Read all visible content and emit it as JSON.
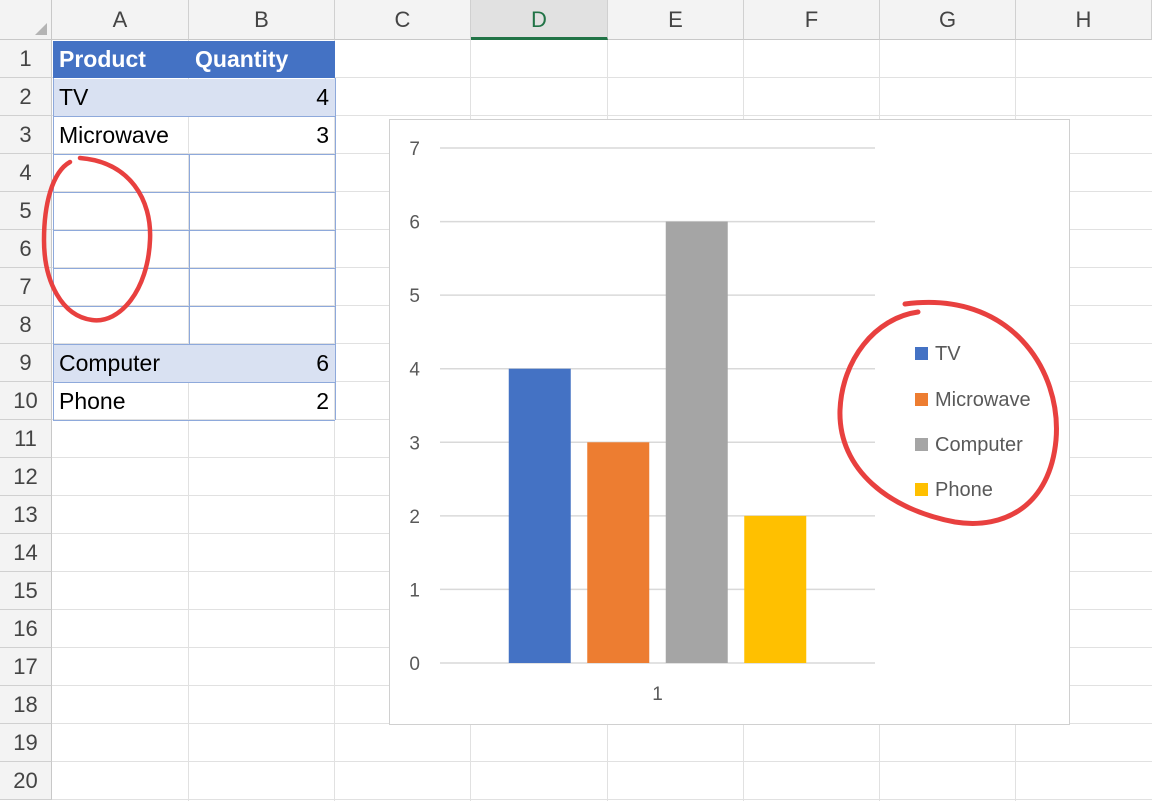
{
  "columns": [
    "A",
    "B",
    "C",
    "D",
    "E",
    "F",
    "G",
    "H"
  ],
  "selected_column": "D",
  "rows": [
    "1",
    "2",
    "3",
    "4",
    "5",
    "6",
    "7",
    "8",
    "9",
    "10",
    "11",
    "12",
    "13",
    "14",
    "15",
    "16",
    "17",
    "18",
    "19",
    "20"
  ],
  "table": {
    "headers": {
      "product": "Product",
      "quantity": "Quantity"
    },
    "data": [
      {
        "product": "TV",
        "quantity": "4"
      },
      {
        "product": "Microwave",
        "quantity": "3"
      },
      {
        "product": "",
        "quantity": ""
      },
      {
        "product": "",
        "quantity": ""
      },
      {
        "product": "",
        "quantity": ""
      },
      {
        "product": "",
        "quantity": ""
      },
      {
        "product": "",
        "quantity": ""
      },
      {
        "product": "Computer",
        "quantity": "6"
      },
      {
        "product": "Phone",
        "quantity": "2"
      }
    ]
  },
  "colors": {
    "table_header": "#4472c4",
    "table_band": "#d9e1f2",
    "annotation": "#e8403f",
    "selected_header_text": "#217346"
  },
  "chart_data": {
    "type": "bar",
    "categories": [
      "1"
    ],
    "series": [
      {
        "name": "TV",
        "values": [
          4
        ],
        "color": "#4472c4"
      },
      {
        "name": "Microwave",
        "values": [
          3
        ],
        "color": "#ed7d31"
      },
      {
        "name": "Computer",
        "values": [
          6
        ],
        "color": "#a5a5a5"
      },
      {
        "name": "Phone",
        "values": [
          2
        ],
        "color": "#ffc000"
      }
    ],
    "y_ticks": [
      "0",
      "1",
      "2",
      "3",
      "4",
      "5",
      "6",
      "7"
    ],
    "ylim": [
      0,
      7
    ],
    "grid": true,
    "legend_placement": "right"
  }
}
